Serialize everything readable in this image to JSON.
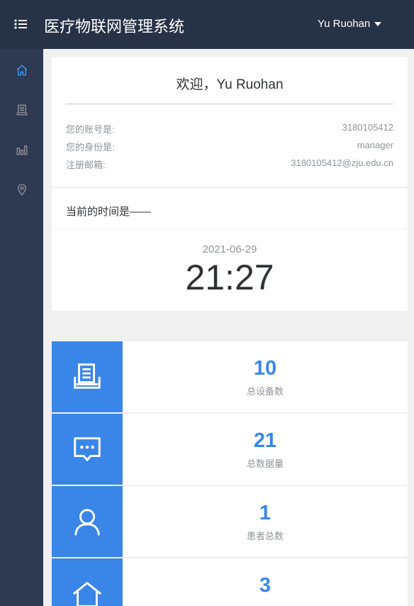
{
  "header": {
    "app_title": "医疗物联网管理系统",
    "user_name": "Yu Ruohan",
    "menu_icon": "list-menu-icon",
    "dropdown_icon": "caret-down-icon"
  },
  "sidebar": {
    "items": [
      {
        "icon": "home-icon",
        "active": true
      },
      {
        "icon": "book-icon",
        "active": false
      },
      {
        "icon": "bar-chart-icon",
        "active": false
      },
      {
        "icon": "location-pin-icon",
        "active": false
      }
    ],
    "active_color": "#409eff",
    "inactive_color": "#909399"
  },
  "welcome": {
    "title": "欢迎，Yu Ruohan",
    "account_label": "您的账号是:",
    "account_value": "3180105412",
    "role_label": "您的身份是:",
    "role_value": "manager",
    "email_label": "注册邮箱:",
    "email_value": "3180105412@zju.edu.cn"
  },
  "time": {
    "label": "当前的时间是——",
    "date": "2021-06-29",
    "clock": "21:27"
  },
  "stats": [
    {
      "value": "10",
      "label": "总设备数",
      "icon": "device-book-icon"
    },
    {
      "value": "21",
      "label": "总数据量",
      "icon": "message-icon"
    },
    {
      "value": "1",
      "label": "患者总数",
      "icon": "user-icon"
    },
    {
      "value": "3",
      "label": "",
      "icon": "home-icon"
    }
  ],
  "colors": {
    "header_bg": "#263246",
    "sidebar_bg": "#2e3a52",
    "accent": "#3a86e8"
  }
}
